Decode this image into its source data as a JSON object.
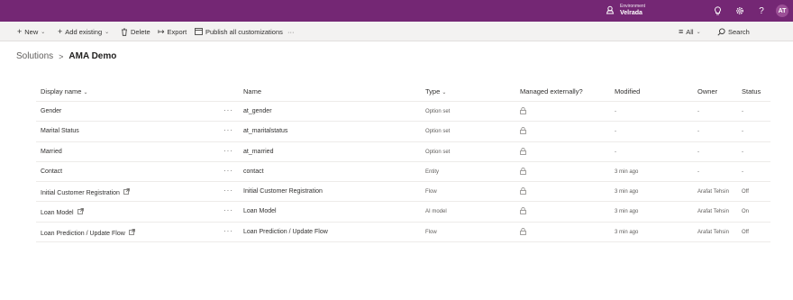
{
  "header": {
    "environment_label": "Environment",
    "environment_name": "Velrada",
    "avatar_initials": "AT"
  },
  "commandbar": {
    "new_label": "New",
    "add_existing_label": "Add existing",
    "delete_label": "Delete",
    "export_label": "Export",
    "publish_label": "Publish all customizations",
    "more_label": "···",
    "filter_label": "All",
    "search_label": "Search"
  },
  "breadcrumb": {
    "root": "Solutions",
    "separator": ">",
    "current": "AMA Demo"
  },
  "table": {
    "headers": {
      "display_name": "Display name",
      "name": "Name",
      "type": "Type",
      "managed": "Managed externally?",
      "modified": "Modified",
      "owner": "Owner",
      "status": "Status"
    },
    "rows": [
      {
        "display": "Gender",
        "external": false,
        "name": "at_gender",
        "type": "Option set",
        "modified": "-",
        "owner": "-",
        "status": "-"
      },
      {
        "display": "Marital Status",
        "external": false,
        "name": "at_maritalstatus",
        "type": "Option set",
        "modified": "-",
        "owner": "-",
        "status": "-"
      },
      {
        "display": "Married",
        "external": false,
        "name": "at_married",
        "type": "Option set",
        "modified": "-",
        "owner": "-",
        "status": "-"
      },
      {
        "display": "Contact",
        "external": false,
        "name": "contact",
        "type": "Entity",
        "modified": "3 min ago",
        "owner": "-",
        "status": "-"
      },
      {
        "display": "Initial Customer Registration",
        "external": true,
        "name": "Initial Customer Registration",
        "type": "Flow",
        "modified": "3 min ago",
        "owner": "Arafat Tehsin",
        "status": "Off"
      },
      {
        "display": "Loan Model",
        "external": true,
        "name": "Loan Model",
        "type": "AI model",
        "modified": "3 min ago",
        "owner": "Arafat Tehsin",
        "status": "On"
      },
      {
        "display": "Loan Prediction / Update Flow",
        "external": true,
        "name": "Loan Prediction / Update Flow",
        "type": "Flow",
        "modified": "3 min ago",
        "owner": "Arafat Tehsin",
        "status": "Off"
      }
    ]
  },
  "colors": {
    "header_bg": "#742774",
    "commandbar_bg": "#f3f2f1"
  },
  "icons": [
    "environment-icon",
    "lightbulb-icon",
    "gear-icon",
    "help-icon",
    "plus-icon",
    "chevron-down-icon",
    "trash-icon",
    "export-icon",
    "publish-icon",
    "filter-icon",
    "search-icon",
    "lock-icon",
    "external-link-icon"
  ]
}
